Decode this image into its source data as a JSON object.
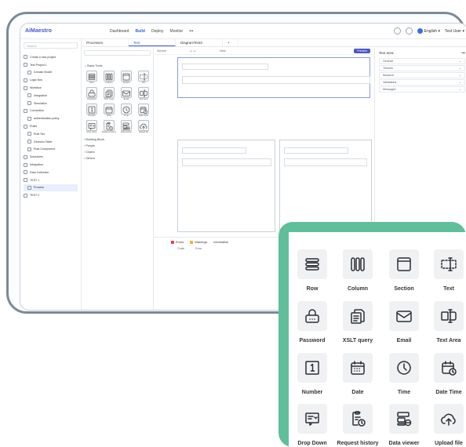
{
  "app": {
    "logo": "AiMaestro",
    "top_nav": [
      "Dashboard",
      "Build",
      "Deploy",
      "Monitor",
      "•••"
    ],
    "language": "English",
    "user": "Test User"
  },
  "sidebar": {
    "search_placeholder": "Search",
    "items": [
      "Create a new project",
      "Test Project 1",
      "Domain Model",
      "Logic flow",
      "Workflow",
      "Integration",
      "Simulation",
      "Connection",
      "authentication policy",
      "Rules",
      "Rule Set",
      "Decision Table",
      "Rule Component",
      "Schedules",
      "Integration",
      "Data Collection",
      "TEST 1",
      "Process",
      "TEST 2"
    ]
  },
  "tabs": [
    "Processes",
    "Test",
    "DiagramTest3",
    "+"
  ],
  "palette": {
    "search_placeholder": "Search",
    "category_open": "Basic Tools",
    "mini_labels": [
      "Row",
      "Column",
      "Section",
      "Text",
      "Password",
      "XSLT query",
      "Email",
      "Text Area",
      "Number",
      "Date",
      "Time",
      "Date Time",
      "Drop Down",
      "Request history",
      "Data viewer",
      "Upload file"
    ],
    "categories_closed": [
      "Building Block",
      "People",
      "Charts",
      "Others"
    ]
  },
  "canvas": {
    "toolbar_left": "Screen",
    "toolbar_mid": "View",
    "preview": "Preview",
    "section_tag": "Section"
  },
  "bottom_panel": {
    "tabs": [
      "Errors",
      "Warnings",
      "Information"
    ],
    "columns": [
      "Code",
      "Error"
    ]
  },
  "right_panel": {
    "title": "Text area",
    "rows": [
      "General",
      "Themes",
      "Advance",
      "Validations",
      "Messages"
    ]
  },
  "zoom": {
    "items": [
      {
        "label": "Row",
        "icon": "row-icon"
      },
      {
        "label": "Column",
        "icon": "column-icon"
      },
      {
        "label": "Section",
        "icon": "section-icon"
      },
      {
        "label": "Text",
        "icon": "text-field-icon"
      },
      {
        "label": "Password",
        "icon": "password-lock-icon"
      },
      {
        "label": "XSLT query",
        "icon": "xslt-query-icon"
      },
      {
        "label": "Email",
        "icon": "email-icon"
      },
      {
        "label": "Text Area",
        "icon": "text-area-icon"
      },
      {
        "label": "Number",
        "icon": "number-icon"
      },
      {
        "label": "Date",
        "icon": "date-icon"
      },
      {
        "label": "Time",
        "icon": "time-icon"
      },
      {
        "label": "Date Time",
        "icon": "date-time-icon"
      },
      {
        "label": "Drop Down",
        "icon": "drop-down-icon"
      },
      {
        "label": "Request history",
        "icon": "request-history-icon"
      },
      {
        "label": "Data viewer",
        "icon": "data-viewer-icon"
      },
      {
        "label": "Upload file",
        "icon": "upload-file-icon"
      }
    ]
  },
  "colors": {
    "accent": "#2f5ee8",
    "brand": "#4a56c9",
    "card_green": "#5fbf9a",
    "error": "#e04b4b",
    "warning": "#f2b233"
  }
}
